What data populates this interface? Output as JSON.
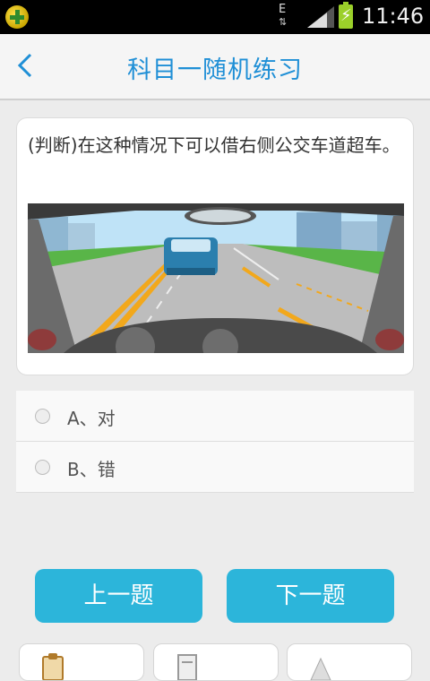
{
  "status_bar": {
    "network_type": "E",
    "network_arrows": "⇅",
    "time": "11:46",
    "icons": [
      "app-icon",
      "signal-icon",
      "battery-charging-icon"
    ]
  },
  "header": {
    "back_icon": "chevron-left-icon",
    "title": "科目一随机练习"
  },
  "question": {
    "text": "(判断)在这种情况下可以借右侧公交车道超车。",
    "image": "driving-scene-bus-lane"
  },
  "options": [
    {
      "label": "A、对"
    },
    {
      "label": "B、错"
    }
  ],
  "buttons": {
    "prev": "上一题",
    "next": "下一题"
  },
  "bottom_tabs": [
    "clipboard-icon",
    "document-icon",
    "warning-icon"
  ],
  "colors": {
    "accent": "#1f8fd6",
    "button": "#2cb5da",
    "background": "#ececec"
  }
}
